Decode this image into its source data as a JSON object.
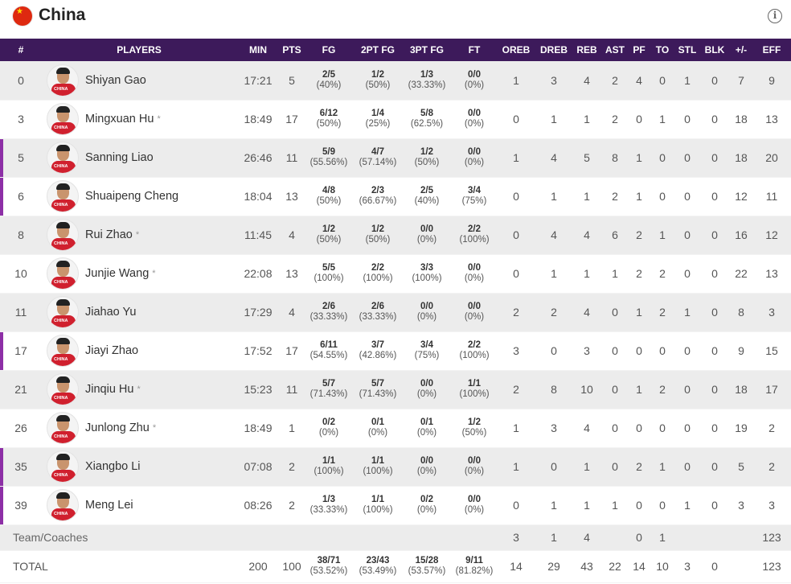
{
  "team": {
    "name": "China"
  },
  "columns": [
    "#",
    "PLAYERS",
    "MIN",
    "PTS",
    "FG",
    "2PT FG",
    "3PT FG",
    "FT",
    "OREB",
    "DREB",
    "REB",
    "AST",
    "PF",
    "TO",
    "STL",
    "BLK",
    "+/-",
    "EFF"
  ],
  "players": [
    {
      "num": "0",
      "name": "Shiyan Gao",
      "star": "",
      "min": "17:21",
      "pts": "5",
      "fg": [
        "2/5",
        "(40%)"
      ],
      "fg2": [
        "1/2",
        "(50%)"
      ],
      "fg3": [
        "1/3",
        "(33.33%)"
      ],
      "ft": [
        "0/0",
        "(0%)"
      ],
      "oreb": "1",
      "dreb": "3",
      "reb": "4",
      "ast": "2",
      "pf": "4",
      "to": "0",
      "stl": "1",
      "blk": "0",
      "pm": "7",
      "eff": "9",
      "starter": false
    },
    {
      "num": "3",
      "name": "Mingxuan Hu",
      "star": "*",
      "min": "18:49",
      "pts": "17",
      "fg": [
        "6/12",
        "(50%)"
      ],
      "fg2": [
        "1/4",
        "(25%)"
      ],
      "fg3": [
        "5/8",
        "(62.5%)"
      ],
      "ft": [
        "0/0",
        "(0%)"
      ],
      "oreb": "0",
      "dreb": "1",
      "reb": "1",
      "ast": "2",
      "pf": "0",
      "to": "1",
      "stl": "0",
      "blk": "0",
      "pm": "18",
      "eff": "13",
      "starter": false
    },
    {
      "num": "5",
      "name": "Sanning Liao",
      "star": "",
      "min": "26:46",
      "pts": "11",
      "fg": [
        "5/9",
        "(55.56%)"
      ],
      "fg2": [
        "4/7",
        "(57.14%)"
      ],
      "fg3": [
        "1/2",
        "(50%)"
      ],
      "ft": [
        "0/0",
        "(0%)"
      ],
      "oreb": "1",
      "dreb": "4",
      "reb": "5",
      "ast": "8",
      "pf": "1",
      "to": "0",
      "stl": "0",
      "blk": "0",
      "pm": "18",
      "eff": "20",
      "starter": true
    },
    {
      "num": "6",
      "name": "Shuaipeng Cheng",
      "star": "",
      "min": "18:04",
      "pts": "13",
      "fg": [
        "4/8",
        "(50%)"
      ],
      "fg2": [
        "2/3",
        "(66.67%)"
      ],
      "fg3": [
        "2/5",
        "(40%)"
      ],
      "ft": [
        "3/4",
        "(75%)"
      ],
      "oreb": "0",
      "dreb": "1",
      "reb": "1",
      "ast": "2",
      "pf": "1",
      "to": "0",
      "stl": "0",
      "blk": "0",
      "pm": "12",
      "eff": "11",
      "starter": true
    },
    {
      "num": "8",
      "name": "Rui Zhao",
      "star": "*",
      "min": "11:45",
      "pts": "4",
      "fg": [
        "1/2",
        "(50%)"
      ],
      "fg2": [
        "1/2",
        "(50%)"
      ],
      "fg3": [
        "0/0",
        "(0%)"
      ],
      "ft": [
        "2/2",
        "(100%)"
      ],
      "oreb": "0",
      "dreb": "4",
      "reb": "4",
      "ast": "6",
      "pf": "2",
      "to": "1",
      "stl": "0",
      "blk": "0",
      "pm": "16",
      "eff": "12",
      "starter": false
    },
    {
      "num": "10",
      "name": "Junjie Wang",
      "star": "*",
      "min": "22:08",
      "pts": "13",
      "fg": [
        "5/5",
        "(100%)"
      ],
      "fg2": [
        "2/2",
        "(100%)"
      ],
      "fg3": [
        "3/3",
        "(100%)"
      ],
      "ft": [
        "0/0",
        "(0%)"
      ],
      "oreb": "0",
      "dreb": "1",
      "reb": "1",
      "ast": "1",
      "pf": "2",
      "to": "2",
      "stl": "0",
      "blk": "0",
      "pm": "22",
      "eff": "13",
      "starter": false
    },
    {
      "num": "11",
      "name": "Jiahao Yu",
      "star": "",
      "min": "17:29",
      "pts": "4",
      "fg": [
        "2/6",
        "(33.33%)"
      ],
      "fg2": [
        "2/6",
        "(33.33%)"
      ],
      "fg3": [
        "0/0",
        "(0%)"
      ],
      "ft": [
        "0/0",
        "(0%)"
      ],
      "oreb": "2",
      "dreb": "2",
      "reb": "4",
      "ast": "0",
      "pf": "1",
      "to": "2",
      "stl": "1",
      "blk": "0",
      "pm": "8",
      "eff": "3",
      "starter": false
    },
    {
      "num": "17",
      "name": "Jiayi Zhao",
      "star": "",
      "min": "17:52",
      "pts": "17",
      "fg": [
        "6/11",
        "(54.55%)"
      ],
      "fg2": [
        "3/7",
        "(42.86%)"
      ],
      "fg3": [
        "3/4",
        "(75%)"
      ],
      "ft": [
        "2/2",
        "(100%)"
      ],
      "oreb": "3",
      "dreb": "0",
      "reb": "3",
      "ast": "0",
      "pf": "0",
      "to": "0",
      "stl": "0",
      "blk": "0",
      "pm": "9",
      "eff": "15",
      "starter": true
    },
    {
      "num": "21",
      "name": "Jinqiu Hu",
      "star": "*",
      "min": "15:23",
      "pts": "11",
      "fg": [
        "5/7",
        "(71.43%)"
      ],
      "fg2": [
        "5/7",
        "(71.43%)"
      ],
      "fg3": [
        "0/0",
        "(0%)"
      ],
      "ft": [
        "1/1",
        "(100%)"
      ],
      "oreb": "2",
      "dreb": "8",
      "reb": "10",
      "ast": "0",
      "pf": "1",
      "to": "2",
      "stl": "0",
      "blk": "0",
      "pm": "18",
      "eff": "17",
      "starter": false
    },
    {
      "num": "26",
      "name": "Junlong Zhu",
      "star": "*",
      "min": "18:49",
      "pts": "1",
      "fg": [
        "0/2",
        "(0%)"
      ],
      "fg2": [
        "0/1",
        "(0%)"
      ],
      "fg3": [
        "0/1",
        "(0%)"
      ],
      "ft": [
        "1/2",
        "(50%)"
      ],
      "oreb": "1",
      "dreb": "3",
      "reb": "4",
      "ast": "0",
      "pf": "0",
      "to": "0",
      "stl": "0",
      "blk": "0",
      "pm": "19",
      "eff": "2",
      "starter": false
    },
    {
      "num": "35",
      "name": "Xiangbo Li",
      "star": "",
      "min": "07:08",
      "pts": "2",
      "fg": [
        "1/1",
        "(100%)"
      ],
      "fg2": [
        "1/1",
        "(100%)"
      ],
      "fg3": [
        "0/0",
        "(0%)"
      ],
      "ft": [
        "0/0",
        "(0%)"
      ],
      "oreb": "1",
      "dreb": "0",
      "reb": "1",
      "ast": "0",
      "pf": "2",
      "to": "1",
      "stl": "0",
      "blk": "0",
      "pm": "5",
      "eff": "2",
      "starter": true
    },
    {
      "num": "39",
      "name": "Meng Lei",
      "star": "",
      "min": "08:26",
      "pts": "2",
      "fg": [
        "1/3",
        "(33.33%)"
      ],
      "fg2": [
        "1/1",
        "(100%)"
      ],
      "fg3": [
        "0/2",
        "(0%)"
      ],
      "ft": [
        "0/0",
        "(0%)"
      ],
      "oreb": "0",
      "dreb": "1",
      "reb": "1",
      "ast": "1",
      "pf": "0",
      "to": "0",
      "stl": "1",
      "blk": "0",
      "pm": "3",
      "eff": "3",
      "starter": true
    }
  ],
  "team_row": {
    "label": "Team/Coaches",
    "oreb": "3",
    "dreb": "1",
    "reb": "4",
    "ast": "",
    "pf": "0",
    "to": "1",
    "stl": "",
    "blk": "",
    "pm": "",
    "eff": "123"
  },
  "total_row": {
    "label": "TOTAL",
    "min": "200",
    "pts": "100",
    "fg": [
      "38/71",
      "(53.52%)"
    ],
    "fg2": [
      "23/43",
      "(53.49%)"
    ],
    "fg3": [
      "15/28",
      "(53.57%)"
    ],
    "ft": [
      "9/11",
      "(81.82%)"
    ],
    "oreb": "14",
    "dreb": "29",
    "reb": "43",
    "ast": "22",
    "pf": "14",
    "to": "10",
    "stl": "3",
    "blk": "0",
    "pm": "",
    "eff": "123"
  },
  "colors": {
    "header_bg": "#3d1a5b",
    "starter_bar": "#8d2fa6",
    "row_alt": "#ececec"
  },
  "icons": {
    "flag": "china-flag-icon",
    "info": "info-icon"
  }
}
